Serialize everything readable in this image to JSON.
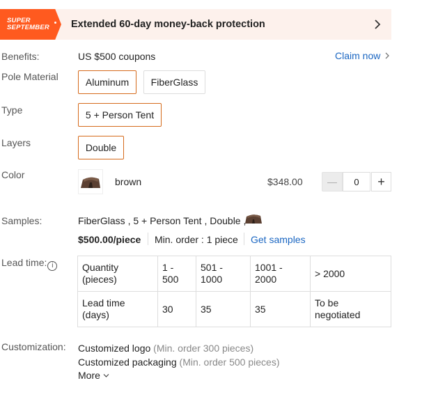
{
  "banner": {
    "badge_line1": "SUPER",
    "badge_line2": "SEPTEMBER",
    "text": "Extended 60-day money-back protection"
  },
  "benefits": {
    "label": "Benefits:",
    "value": "US $500 coupons",
    "link": "Claim now"
  },
  "pole_material": {
    "label": "Pole Material",
    "options": [
      "Aluminum",
      "FiberGlass"
    ],
    "selected": "Aluminum"
  },
  "type": {
    "label": "Type",
    "options": [
      "5 + Person Tent"
    ],
    "selected": "5 + Person Tent"
  },
  "layers": {
    "label": "Layers",
    "options": [
      "Double"
    ],
    "selected": "Double"
  },
  "color": {
    "label": "Color",
    "name": "brown",
    "price": "$348.00",
    "quantity": "0",
    "minus": "—",
    "plus": "+"
  },
  "samples": {
    "label": "Samples:",
    "spec": "FiberGlass , 5 + Person Tent , Double ,",
    "price": "$500.00/piece",
    "min_order": "Min. order : 1 piece",
    "link": "Get samples"
  },
  "lead_time": {
    "label": "Lead time:",
    "info": "i",
    "headers": [
      "Quantity (pieces)",
      "1 - 500",
      "501 - 1000",
      "1001 - 2000",
      "> 2000"
    ],
    "row": [
      "Lead time (days)",
      "30",
      "35",
      "35",
      "To be negotiated"
    ]
  },
  "customization": {
    "label": "Customization:",
    "items": [
      {
        "name": "Customized logo",
        "note": "(Min. order 300 pieces)"
      },
      {
        "name": "Customized packaging",
        "note": "(Min. order 500 pieces)"
      }
    ],
    "more": "More"
  },
  "colors": {
    "accent": "#d56a1b",
    "badge": "#ff5a1f",
    "link": "#1a66c2",
    "banner_bg": "#fdf1ec"
  }
}
